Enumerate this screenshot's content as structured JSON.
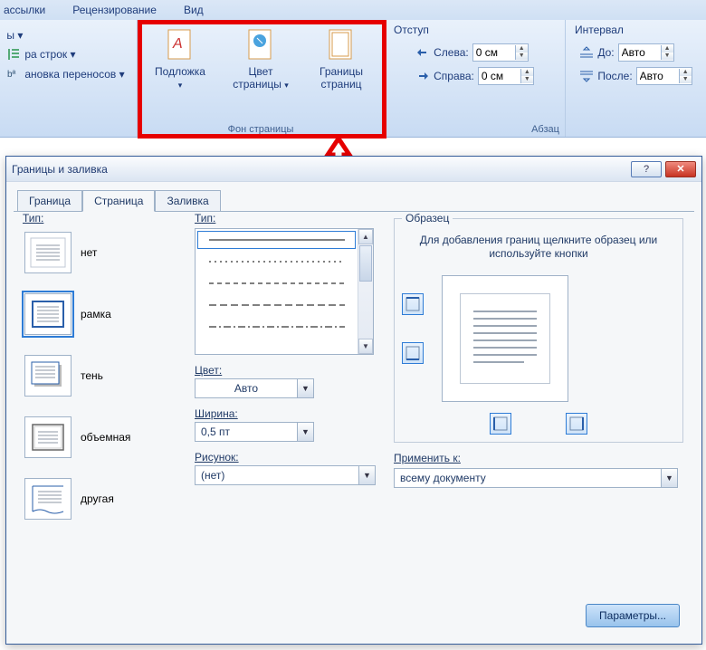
{
  "ribbon_tabs": {
    "t1": "ассылки",
    "t2": "Рецензирование",
    "t3": "Вид"
  },
  "left_group": {
    "item1": "ы ▾",
    "item2": "ра строк ▾",
    "item3": "ановка переносов ▾"
  },
  "bg_group": {
    "label": "Фон страницы",
    "b1": "Подложка",
    "b2": "Цвет страницы",
    "b3": "Границы страниц"
  },
  "indent_group": {
    "title": "Отступ",
    "left_lbl": "Слева:",
    "right_lbl": "Справа:",
    "left_val": "0 см",
    "right_val": "0 см"
  },
  "interval_group": {
    "title": "Интервал",
    "before_lbl": "До:",
    "after_lbl": "После:",
    "before_val": "Авто",
    "after_val": "Авто"
  },
  "abzac_label": "Абзац",
  "dialog": {
    "title": "Границы и заливка",
    "tabs": {
      "t1": "Граница",
      "t2": "Страница",
      "t3": "Заливка"
    },
    "type_label": "Тип:",
    "types": {
      "none": "нет",
      "box": "рамка",
      "shadow": "тень",
      "threeD": "объемная",
      "custom": "другая"
    },
    "style_label": "Тип:",
    "color_label": "Цвет:",
    "color_val": "Авто",
    "width_label": "Ширина:",
    "width_val": "0,5 пт",
    "art_label": "Рисунок:",
    "art_val": "(нет)",
    "preview_legend": "Образец",
    "preview_hint": "Для добавления границ щелкните образец или используйте кнопки",
    "apply_label": "Применить к:",
    "apply_val": "всему документу",
    "params_btn": "Параметры..."
  }
}
